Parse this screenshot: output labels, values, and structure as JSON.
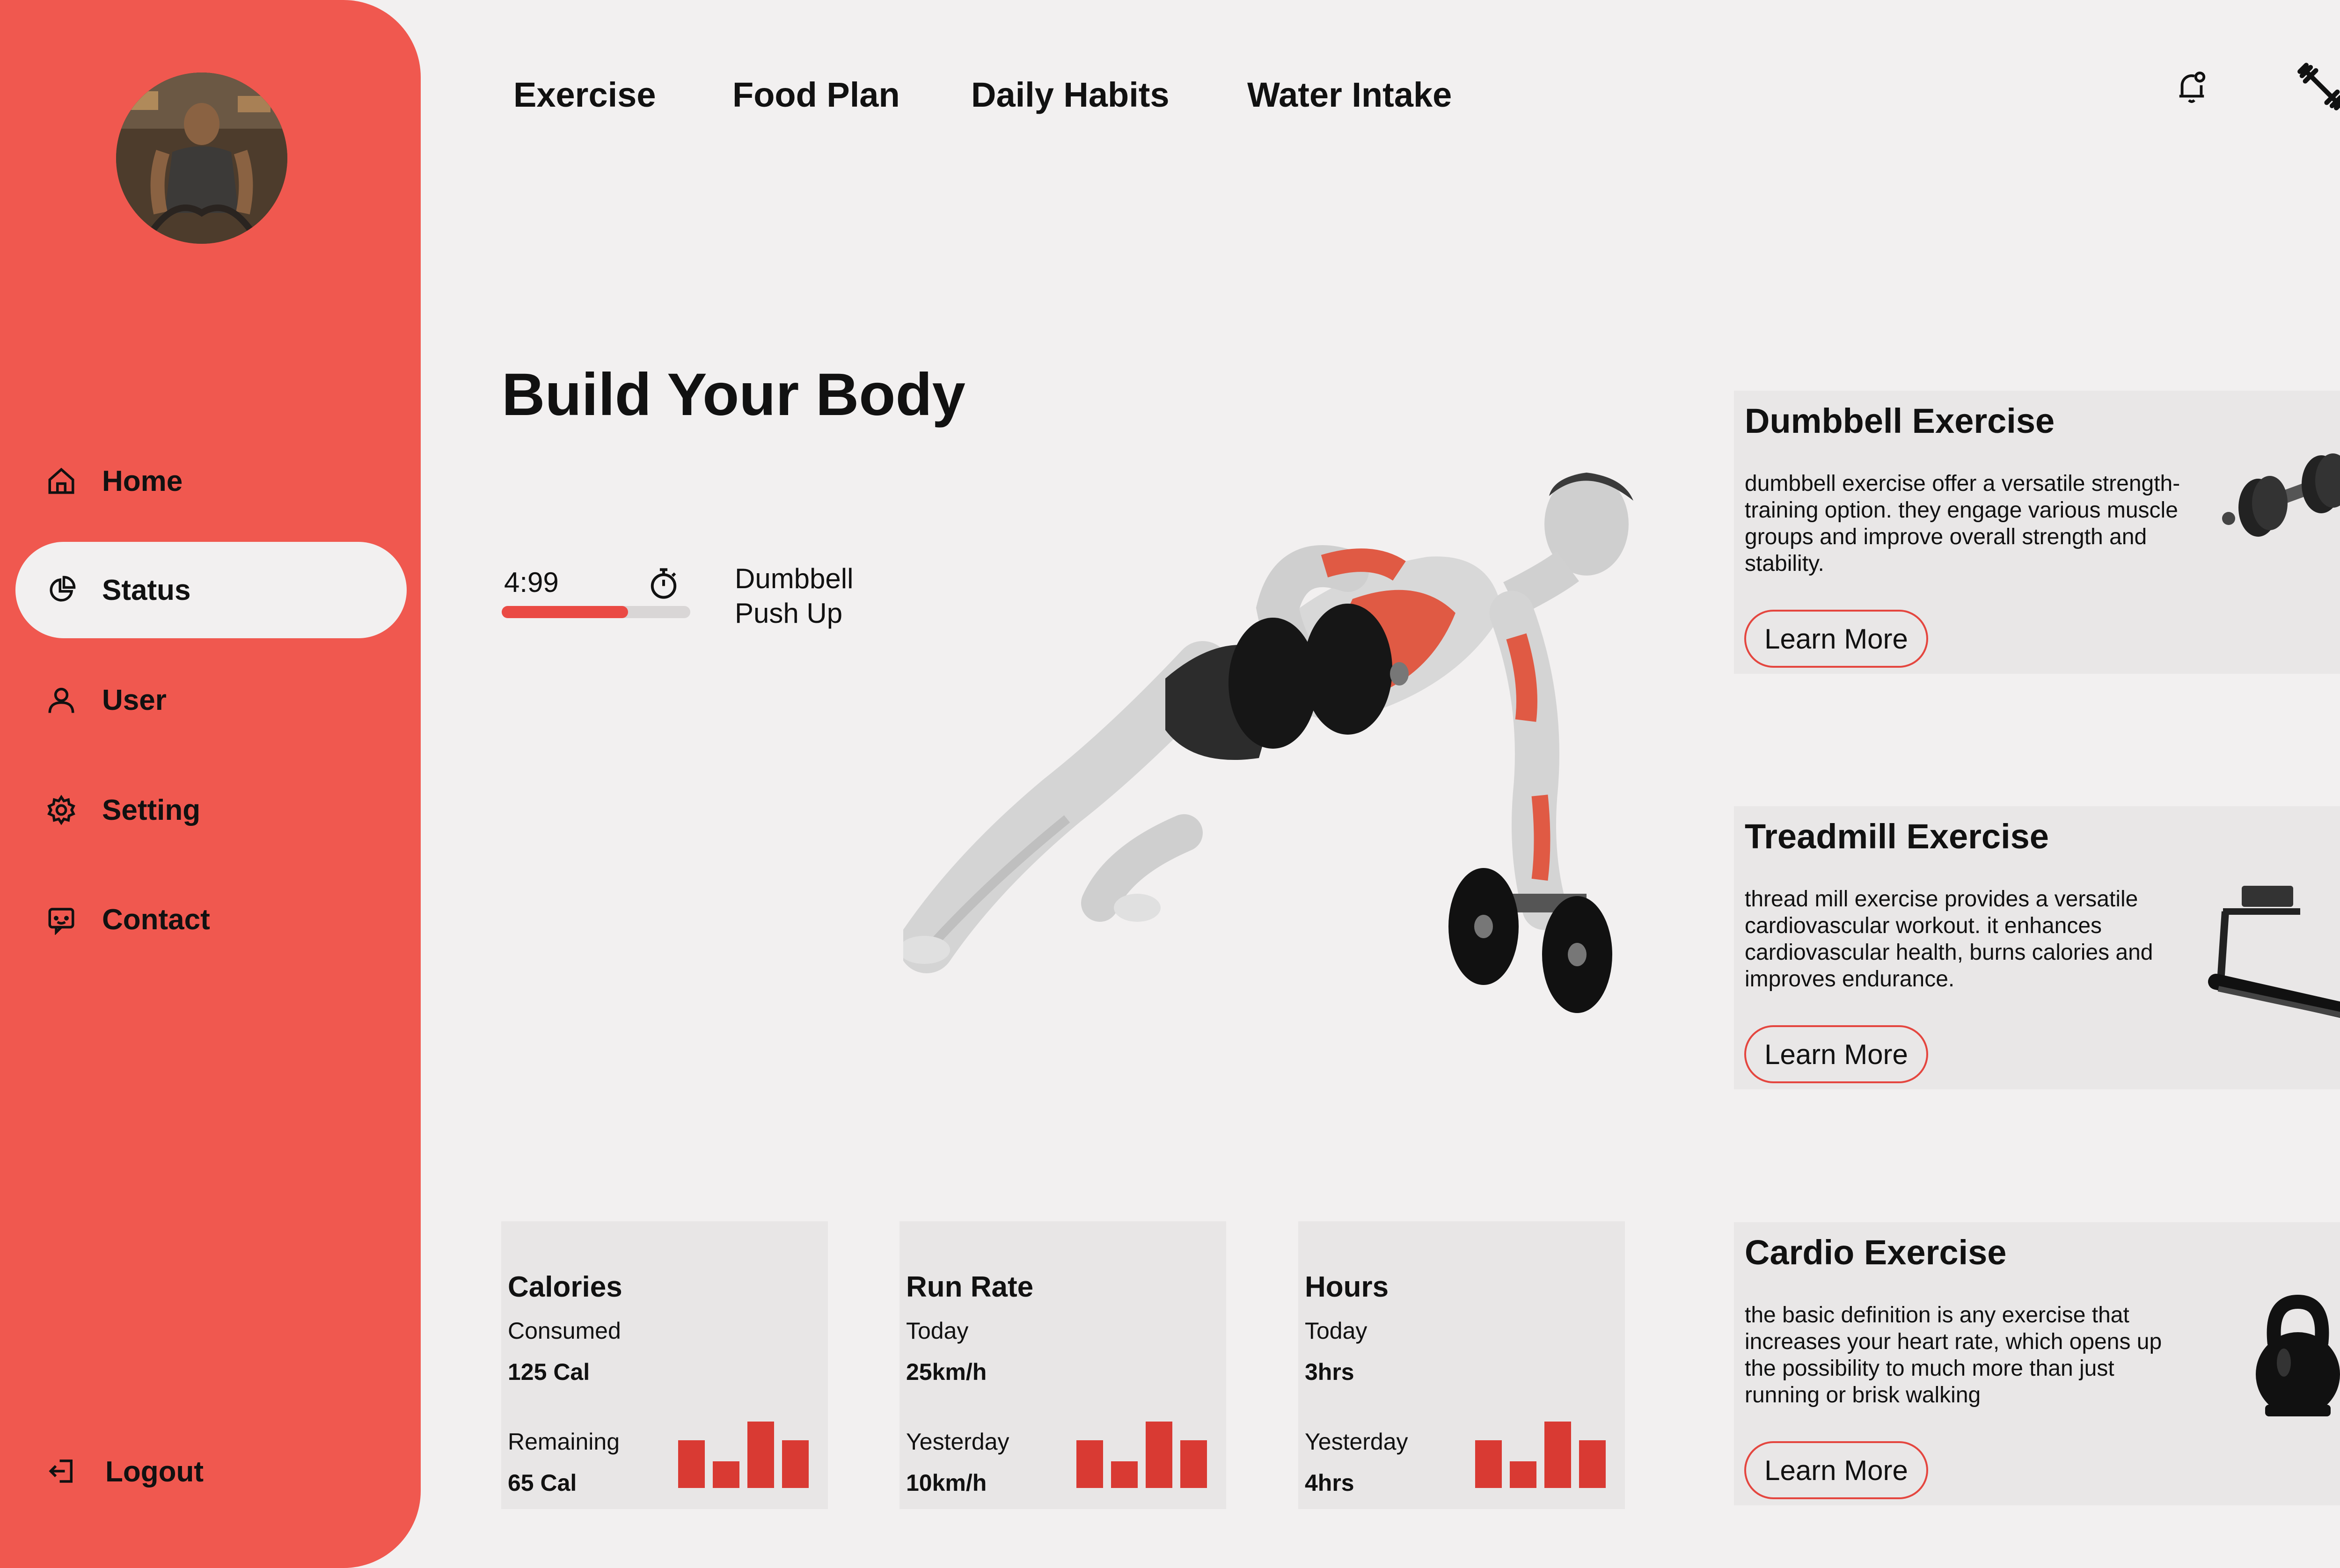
{
  "sidebar": {
    "items": [
      {
        "label": "Home",
        "icon": "home-icon"
      },
      {
        "label": "Status",
        "icon": "pie-chart-icon",
        "active": true
      },
      {
        "label": "User",
        "icon": "user-icon"
      },
      {
        "label": "Setting",
        "icon": "gear-icon"
      },
      {
        "label": "Contact",
        "icon": "contact-icon"
      }
    ],
    "logout_label": "Logout"
  },
  "topnav": {
    "links": [
      "Exercise",
      "Food Plan",
      "Daily Habits",
      "Water Intake"
    ],
    "icons": [
      "bell-icon",
      "dumbbell-icon"
    ]
  },
  "hero": {
    "title": "Build Your Body",
    "timer": "4:99",
    "progress": 0.67,
    "exercise_name": "Dumbbell Push Up"
  },
  "cards": [
    {
      "title": "Dumbbell Exercise",
      "text": "dumbbell exercise offer a versatile strength-training option. they engage various muscle groups and improve overall strength and stability.",
      "button": "Learn More"
    },
    {
      "title": "Treadmill Exercise",
      "text": "thread mill exercise provides a versatile cardiovascular workout. it enhances cardiovascular health, burns calories and improves endurance.",
      "button": "Learn More"
    },
    {
      "title": "Cardio Exercise",
      "text": "the basic definition is any exercise that increases your heart rate, which opens up the possibility to much more than just running or brisk walking",
      "button": "Learn More"
    }
  ],
  "stats": [
    {
      "title": "Calories",
      "label1": "Consumed",
      "value1": "125 Cal",
      "label2": "Remaining",
      "value2": "65 Cal"
    },
    {
      "title": "Run Rate",
      "label1": "Today",
      "value1": "25km/h",
      "label2": "Yesterday",
      "value2": "10km/h"
    },
    {
      "title": "Hours",
      "label1": "Today",
      "value1": "3hrs",
      "label2": "Yesterday",
      "value2": "4hrs"
    }
  ],
  "colors": {
    "accent": "#f0584f",
    "bar": "#d93a33",
    "background": "#f2f0f0"
  }
}
